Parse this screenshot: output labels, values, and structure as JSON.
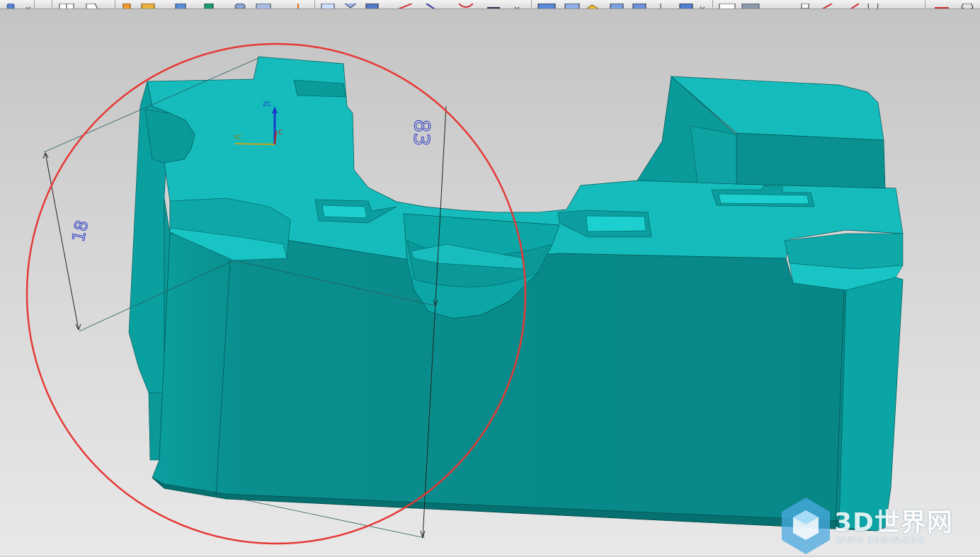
{
  "window": {
    "toolbar_icons": [
      "view-orient-icon",
      "render-style-icon",
      "sheet-icon",
      "snap-icon",
      "fit-icon",
      "color-icon",
      "box-icon",
      "cylinder-icon",
      "block-icon",
      "extrude-icon",
      "revolve-icon",
      "face-icon",
      "analysis-icon",
      "sketch-icon",
      "line-icon",
      "arc-icon",
      "dimension-icon",
      "measure-icon",
      "section-icon",
      "layer-icon",
      "point-icon",
      "circle-icon",
      "pentagon-icon"
    ]
  },
  "viewport": {
    "csys": {
      "z_label": "ZC",
      "y_label": "YC",
      "x_label": "C"
    },
    "dimensions": [
      {
        "name": "height-dimension",
        "text": "83"
      },
      {
        "name": "depth-dimension",
        "text": "18"
      }
    ],
    "annotation_color": "#e53935",
    "model_color": "#0fb3b3"
  },
  "watermark": {
    "title": "3D世界网",
    "subtitle": "WWW.3DSJW.COM"
  }
}
